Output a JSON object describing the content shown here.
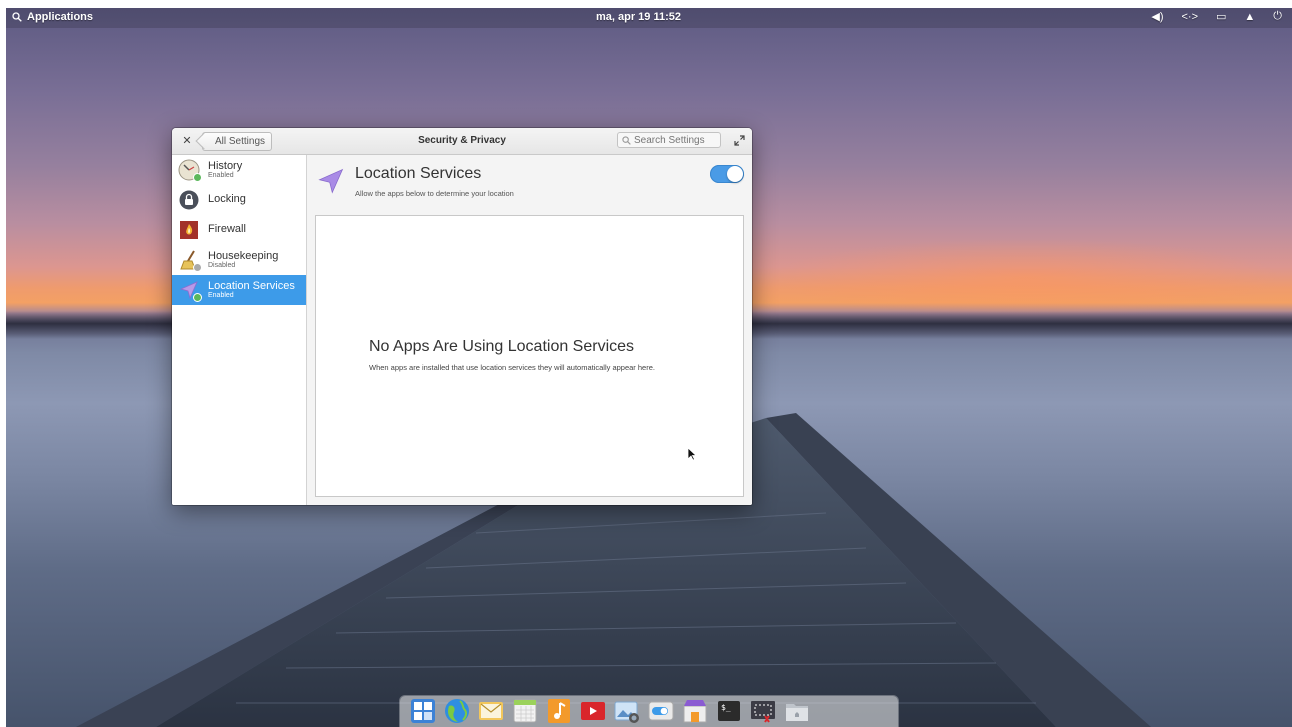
{
  "panel": {
    "applications_label": "Applications",
    "clock": "ma, apr 19   11:52",
    "indicators": [
      "volume-icon",
      "network-icon",
      "battery-icon",
      "notifications-icon",
      "power-icon"
    ]
  },
  "window": {
    "title": "Security & Privacy",
    "back_label": "All Settings",
    "search_placeholder": "Search Settings"
  },
  "sidebar": {
    "items": [
      {
        "label": "History",
        "sub": "Enabled",
        "icon": "history-icon",
        "status_color": "#5cb85c"
      },
      {
        "label": "Locking",
        "sub": "",
        "icon": "lock-icon",
        "status_color": ""
      },
      {
        "label": "Firewall",
        "sub": "",
        "icon": "firewall-icon",
        "status_color": ""
      },
      {
        "label": "Housekeeping",
        "sub": "Disabled",
        "icon": "broom-icon",
        "status_color": "#aaaaaa"
      },
      {
        "label": "Location Services",
        "sub": "Enabled",
        "icon": "location-icon",
        "status_color": "#5cb85c"
      }
    ]
  },
  "content": {
    "heading": "Location Services",
    "description": "Allow the apps below to determine your location",
    "toggle_on": true,
    "empty_title": "No Apps Are Using Location Services",
    "empty_description": "When apps are installed that use location services they will automatically appear here."
  },
  "dock": {
    "items": [
      "multitasking-icon",
      "browser-icon",
      "mail-icon",
      "calendar-icon",
      "music-icon",
      "videos-icon",
      "photos-icon",
      "settings-toggle-icon",
      "appcenter-icon",
      "terminal-icon",
      "screenshot-icon",
      "files-icon"
    ]
  },
  "colors": {
    "accent": "#3d9be9",
    "enabled": "#5cb85c",
    "disabled": "#aaaaaa"
  }
}
